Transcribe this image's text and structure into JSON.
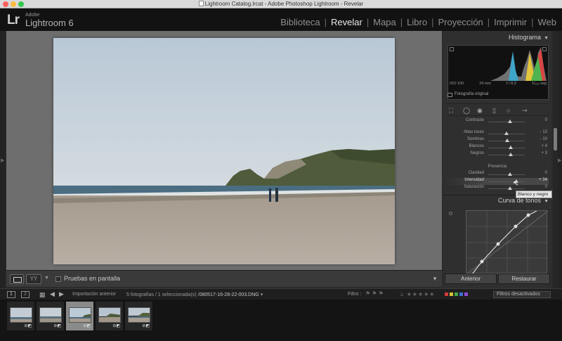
{
  "window": {
    "title": "Lightroom Catalog.lrcat - Adobe Photoshop Lightroom - Revelar"
  },
  "identity": {
    "logo": "Lr",
    "brand_line1": "Adobe",
    "brand_line2": "Lightroom 6"
  },
  "modules": [
    {
      "label": "Biblioteca",
      "active": false
    },
    {
      "label": "Revelar",
      "active": true
    },
    {
      "label": "Mapa",
      "active": false
    },
    {
      "label": "Libro",
      "active": false
    },
    {
      "label": "Proyección",
      "active": false
    },
    {
      "label": "Imprimir",
      "active": false
    },
    {
      "label": "Web",
      "active": false
    }
  ],
  "toolbar": {
    "compare_label": "YY",
    "softproof_label": "Pruebas en pantalla"
  },
  "histogram": {
    "title": "Histograma",
    "iso": "ISO 100",
    "focal": "24 mm",
    "aperture": "f / 8,0",
    "shutter": "1/₁₂₅ seg",
    "original_label": "Fotografía original"
  },
  "basic": {
    "contrast": {
      "label": "Contraste",
      "value": "0"
    },
    "highlights": {
      "label": "Altas luces",
      "value": "- 13"
    },
    "shadows": {
      "label": "Sombras",
      "value": "- 10"
    },
    "whites": {
      "label": "Blancos",
      "value": "+ 4"
    },
    "blacks": {
      "label": "Negros",
      "value": "+ 3"
    },
    "presence_title": "Presencia",
    "clarity": {
      "label": "Claridad",
      "value": "0"
    },
    "vibrance": {
      "label": "Intensidad",
      "value": "+ 34"
    },
    "saturation": {
      "label": "Saturación",
      "value": "0"
    }
  },
  "tooltip": "Blanco y negro",
  "tone_curve": {
    "title": "Curva de tonos"
  },
  "buttons": {
    "previous": "Anterior",
    "reset": "Restaurar"
  },
  "filmstrip_header": {
    "screen1": "1",
    "screen2": "2",
    "source": "Importación anterior",
    "info": "5 fotografías / 1 seleccionada(s) /",
    "filename": "080517-16-28-22-003.DNG",
    "filter_label": "Filtro :",
    "filters_off": "Filtros desactivados"
  },
  "colors": {
    "accent_active": "#e8e8e8",
    "label_red": "#d23b3b",
    "label_yellow": "#d6c33a",
    "label_green": "#3fa84a",
    "label_blue": "#3c6fd1",
    "label_purple": "#8e4ad0"
  },
  "icons": {
    "logo": "lightroom-logo",
    "panel_toggle": "triangle-down-icon",
    "crop": "crop-icon",
    "spot": "spot-removal-icon",
    "redeye": "red-eye-icon",
    "gradient": "graduated-filter-icon",
    "radial": "radial-filter-icon",
    "brush": "adjustment-brush-icon"
  }
}
